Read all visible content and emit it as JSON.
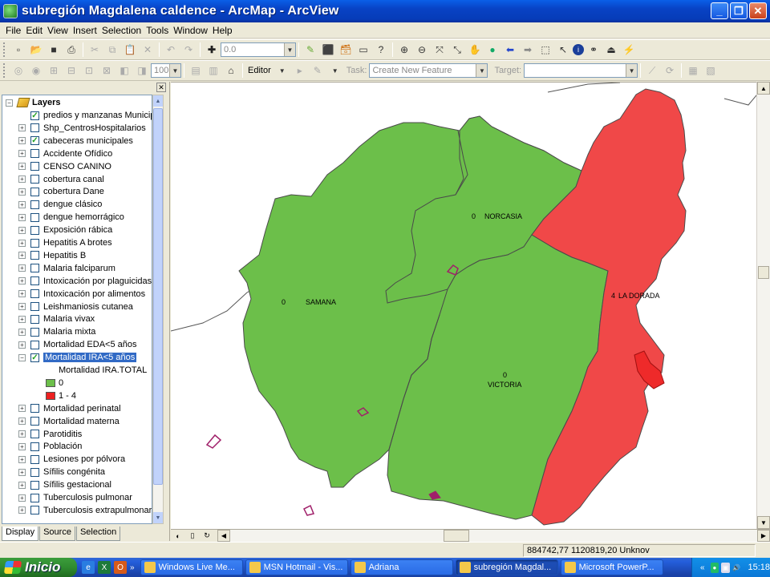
{
  "window": {
    "title": "subregión Magdalena caldence - ArcMap - ArcView",
    "buttons": [
      "_",
      "❐",
      "✕"
    ]
  },
  "menu": [
    "File",
    "Edit",
    "View",
    "Insert",
    "Selection",
    "Tools",
    "Window",
    "Help"
  ],
  "toolbar": {
    "scale_value": "0.0",
    "zoom_value": "100",
    "editor_label": "Editor",
    "task_label": "Task:",
    "task_value": "Create New Feature",
    "target_label": "Target:",
    "target_value": ""
  },
  "toc": {
    "root_label": "Layers",
    "layers": [
      {
        "name": "predios y manzanas Municip",
        "checked": true,
        "expander": ""
      },
      {
        "name": "Shp_CentrosHospitalarios",
        "checked": false,
        "expander": "+"
      },
      {
        "name": "cabeceras municipales",
        "checked": true,
        "expander": "+"
      },
      {
        "name": "Accidente Ofídico",
        "checked": false,
        "expander": "+"
      },
      {
        "name": "CENSO CANINO",
        "checked": false,
        "expander": "+"
      },
      {
        "name": "cobertura canal",
        "checked": false,
        "expander": "+"
      },
      {
        "name": "cobertura Dane",
        "checked": false,
        "expander": "+"
      },
      {
        "name": "dengue clásico",
        "checked": false,
        "expander": "+"
      },
      {
        "name": "dengue hemorrágico",
        "checked": false,
        "expander": "+"
      },
      {
        "name": "Exposición rábica",
        "checked": false,
        "expander": "+"
      },
      {
        "name": "Hepatitis A brotes",
        "checked": false,
        "expander": "+"
      },
      {
        "name": "Hepatitis B",
        "checked": false,
        "expander": "+"
      },
      {
        "name": "Malaria falciparum",
        "checked": false,
        "expander": "+"
      },
      {
        "name": "Intoxicación por plaguicidas",
        "checked": false,
        "expander": "+"
      },
      {
        "name": "Intoxicación por alimentos",
        "checked": false,
        "expander": "+"
      },
      {
        "name": "Leishmaniosis cutanea",
        "checked": false,
        "expander": "+"
      },
      {
        "name": "Malaria vivax",
        "checked": false,
        "expander": "+"
      },
      {
        "name": "Malaria mixta",
        "checked": false,
        "expander": "+"
      },
      {
        "name": "Mortalidad EDA<5 años",
        "checked": false,
        "expander": "+"
      },
      {
        "name": "Mortalidad IRA<5 años",
        "checked": true,
        "expander": "−",
        "selected": true
      }
    ],
    "legend": {
      "field": "Mortalidad IRA.TOTAL",
      "classes": [
        {
          "label": "0",
          "color": "#6cbf4a"
        },
        {
          "label": "1 - 4",
          "color": "#ec2020"
        }
      ]
    },
    "layers_after": [
      {
        "name": "Mortalidad perinatal",
        "checked": false,
        "expander": "+"
      },
      {
        "name": "Mortalidad materna",
        "checked": false,
        "expander": "+"
      },
      {
        "name": "Parotiditis",
        "checked": false,
        "expander": "+"
      },
      {
        "name": "Población",
        "checked": false,
        "expander": "+"
      },
      {
        "name": "Lesiones por pólvora",
        "checked": false,
        "expander": "+"
      },
      {
        "name": "Sífilis congénita",
        "checked": false,
        "expander": "+"
      },
      {
        "name": "Sífilis gestacional",
        "checked": false,
        "expander": "+"
      },
      {
        "name": "Tuberculosis pulmonar",
        "checked": false,
        "expander": "+"
      },
      {
        "name": "Tuberculosis extrapulmonar",
        "checked": false,
        "expander": "+"
      }
    ],
    "tabs": [
      "Display",
      "Source",
      "Selection"
    ]
  },
  "map": {
    "colors": {
      "green": "#6cbf4a",
      "red": "#f04848",
      "outline": "#4a4a4a",
      "magenta": "#a0206a"
    },
    "labels": [
      {
        "value": "0",
        "name": "NORCASIA"
      },
      {
        "value": "0",
        "name": "SAMANA"
      },
      {
        "value": "4",
        "name": "LA DORADA"
      },
      {
        "value": "0",
        "name": "VICTORIA"
      }
    ]
  },
  "status": {
    "coords": "884742,77  1120819,20 Unknov"
  },
  "taskbar": {
    "start_label": "Inicio",
    "tasks": [
      {
        "label": "Windows Live Me...",
        "active": false
      },
      {
        "label": "MSN Hotmail - Vis...",
        "active": false
      },
      {
        "label": "Adriana",
        "active": false
      },
      {
        "label": "subregión Magdal...",
        "active": true
      },
      {
        "label": "Microsoft PowerP...",
        "active": false
      }
    ],
    "clock": "15:18"
  }
}
